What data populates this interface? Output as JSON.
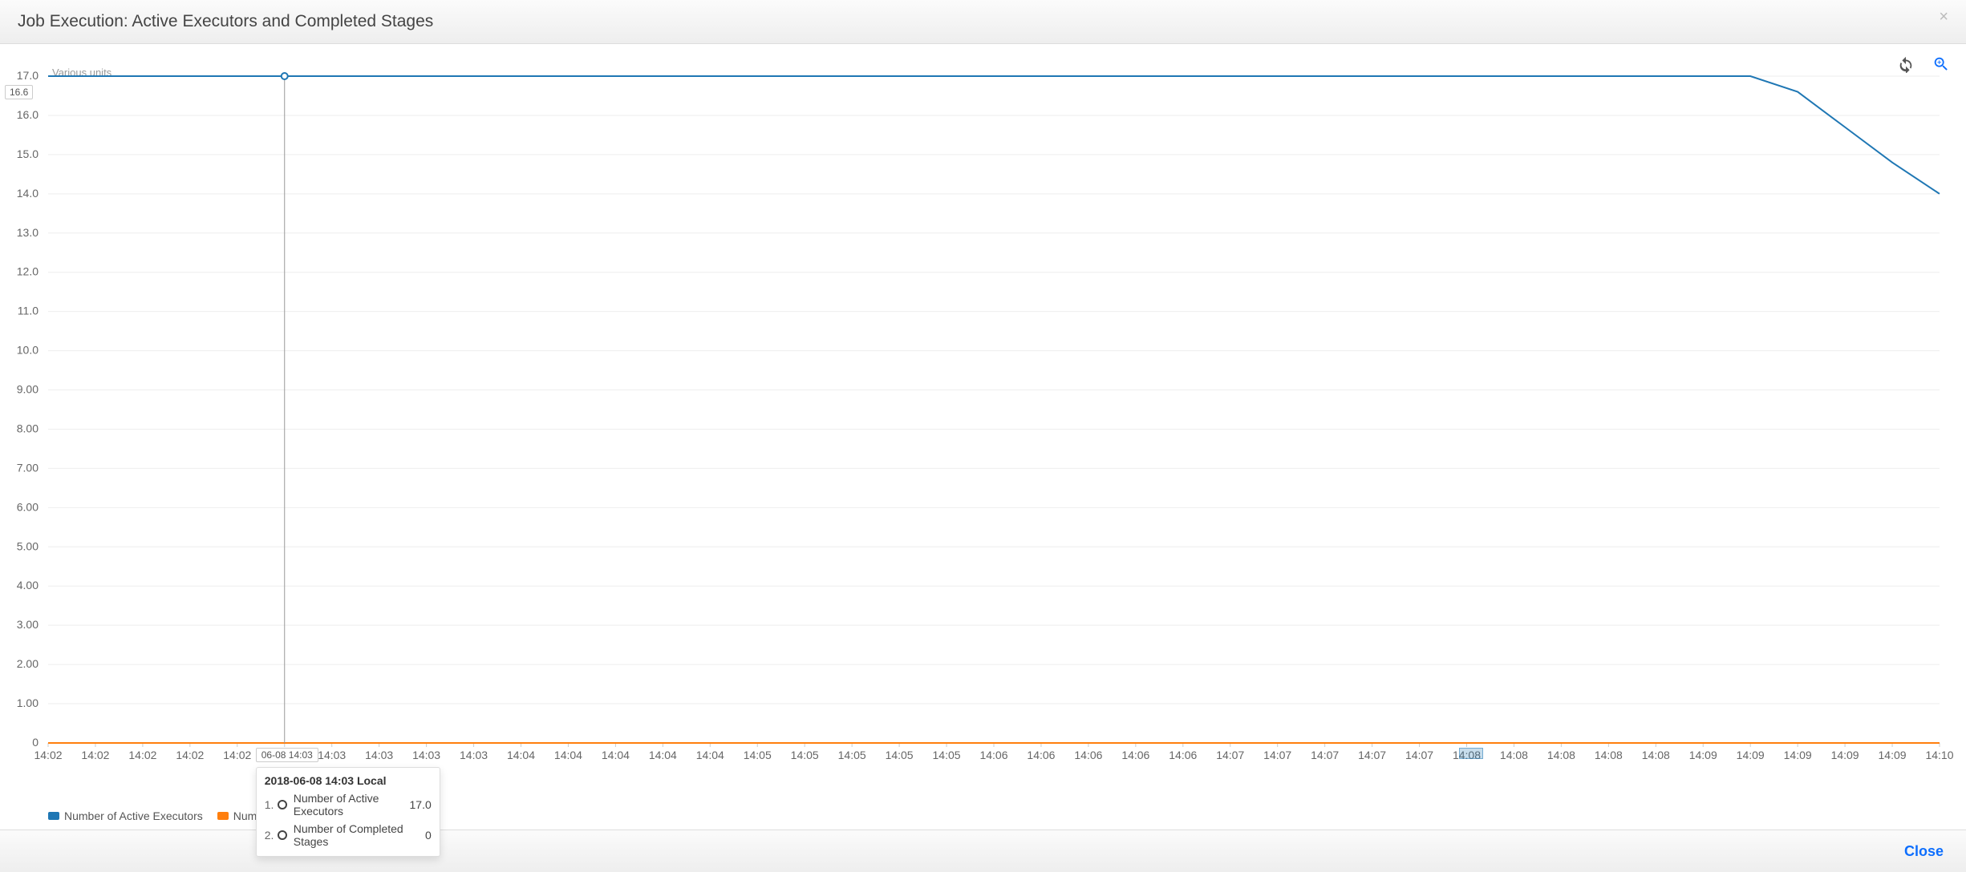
{
  "header": {
    "title": "Job Execution: Active Executors and Completed Stages"
  },
  "footer": {
    "close_label": "Close"
  },
  "axis": {
    "y_label": "Various units"
  },
  "legend": {
    "items": [
      {
        "label": "Number of Active Executors"
      },
      {
        "label": "Number of Completed Stages"
      }
    ]
  },
  "crosshair": {
    "y_flyout": "16.6",
    "x_flyout": "06-08 14:03"
  },
  "tooltip": {
    "title": "2018-06-08 14:03 Local",
    "rows": [
      {
        "idx": "1.",
        "name": "Number of Active Executors",
        "value": "17.0"
      },
      {
        "idx": "2.",
        "name": "Number of Completed Stages",
        "value": "0"
      }
    ]
  },
  "chart_data": {
    "type": "line",
    "title": "Job Execution: Active Executors and Completed Stages",
    "ylabel": "Various units",
    "xlabel": "",
    "ylim": [
      0,
      17
    ],
    "y_ticks": [
      "0",
      "1.00",
      "2.00",
      "3.00",
      "4.00",
      "5.00",
      "6.00",
      "7.00",
      "8.00",
      "9.00",
      "10.0",
      "11.0",
      "12.0",
      "13.0",
      "14.0",
      "15.0",
      "16.0",
      "17.0"
    ],
    "x_ticks": [
      "14:02",
      "14:02",
      "14:02",
      "14:02",
      "14:02",
      "14:03",
      "14:03",
      "14:03",
      "14:03",
      "14:03",
      "14:04",
      "14:04",
      "14:04",
      "14:04",
      "14:04",
      "14:05",
      "14:05",
      "14:05",
      "14:05",
      "14:05",
      "14:06",
      "14:06",
      "14:06",
      "14:06",
      "14:06",
      "14:07",
      "14:07",
      "14:07",
      "14:07",
      "14:07",
      "14:08",
      "14:08",
      "14:08",
      "14:08",
      "14:08",
      "14:09",
      "14:09",
      "14:09",
      "14:09",
      "14:09",
      "14:10"
    ],
    "series": [
      {
        "name": "Number of Active Executors",
        "color": "#1f77b4",
        "values": [
          17,
          17,
          17,
          17,
          17,
          17,
          17,
          17,
          17,
          17,
          17,
          17,
          17,
          17,
          17,
          17,
          17,
          17,
          17,
          17,
          17,
          17,
          17,
          17,
          17,
          17,
          17,
          17,
          17,
          17,
          17,
          17,
          17,
          17,
          17,
          17,
          17,
          16.6,
          15.7,
          14.8,
          14.0
        ]
      },
      {
        "name": "Number of Completed Stages",
        "color": "#ff7f0e",
        "values": [
          0,
          0,
          0,
          0,
          0,
          0,
          0,
          0,
          0,
          0,
          0,
          0,
          0,
          0,
          0,
          0,
          0,
          0,
          0,
          0,
          0,
          0,
          0,
          0,
          0,
          0,
          0,
          0,
          0,
          0,
          0,
          0,
          0,
          0,
          0,
          0,
          0,
          0,
          0,
          0,
          0
        ]
      }
    ],
    "hover_index": 5
  }
}
